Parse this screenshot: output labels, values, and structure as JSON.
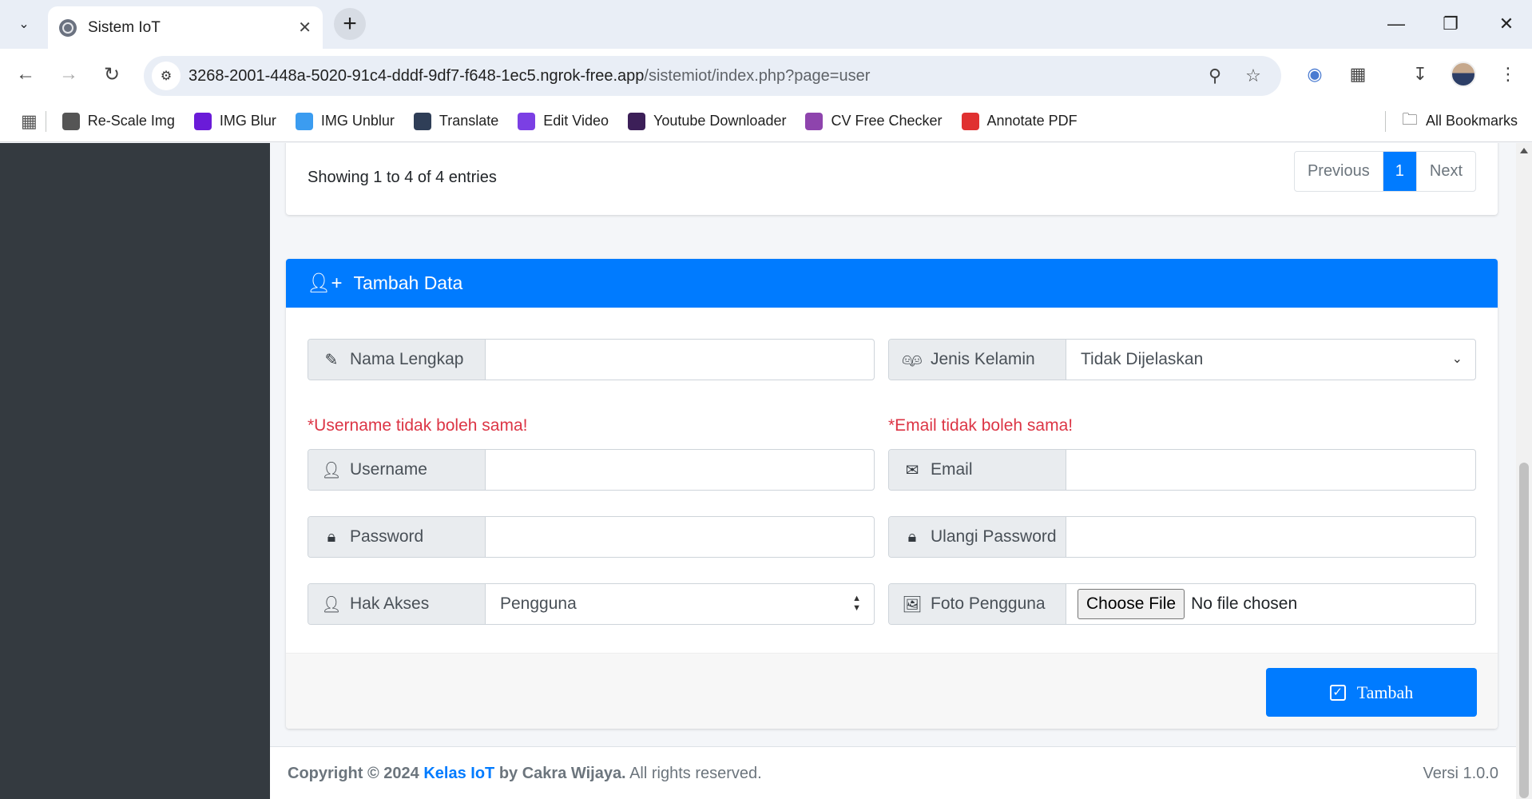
{
  "browser": {
    "tab_title": "Sistem IoT",
    "url_domain": "3268-2001-448a-5020-91c4-dddf-9df7-f648-1ec5.ngrok-free.app",
    "url_path": "/sistemiot/index.php?page=user",
    "bookmarks": [
      {
        "label": "Re-Scale Img",
        "icon": "rescale-icon",
        "color": "#555555"
      },
      {
        "label": "IMG Blur",
        "icon": "img-blur-icon",
        "color": "#6a1bd8"
      },
      {
        "label": "IMG Unblur",
        "icon": "img-unblur-icon",
        "color": "#3b9cf0"
      },
      {
        "label": "Translate",
        "icon": "translate-icon",
        "color": "#2f3e57"
      },
      {
        "label": "Edit Video",
        "icon": "edit-video-icon",
        "color": "#7b3fe4"
      },
      {
        "label": "Youtube Downloader",
        "icon": "youtube-downloader-icon",
        "color": "#3c1f58"
      },
      {
        "label": "CV Free Checker",
        "icon": "cv-checker-icon",
        "color": "#8e44ad"
      },
      {
        "label": "Annotate PDF",
        "icon": "annotate-pdf-icon",
        "color": "#e03131"
      }
    ],
    "all_bookmarks": "All Bookmarks"
  },
  "table_footer": {
    "entries_info": "Showing 1 to 4 of 4 entries",
    "prev": "Previous",
    "page": "1",
    "next": "Next"
  },
  "form": {
    "title": "Tambah Data",
    "nama_label": "Nama Lengkap",
    "nama_value": "",
    "gender_label": "Jenis Kelamin",
    "gender_value": "Tidak Dijelaskan",
    "username_warning": "*Username tidak boleh sama!",
    "email_warning": "*Email tidak boleh sama!",
    "username_label": "Username",
    "username_value": "",
    "email_label": "Email",
    "email_value": "",
    "password_label": "Password",
    "password_value": "",
    "repassword_label": "Ulangi Password",
    "repassword_value": "",
    "akses_label": "Hak Akses",
    "akses_value": "Pengguna",
    "foto_label": "Foto Pengguna",
    "file_button": "Choose File",
    "file_status": "No file chosen",
    "submit": "Tambah"
  },
  "footer": {
    "copyright_prefix": "Copyright © 2024",
    "brand": "Kelas IoT",
    "author": "by Cakra Wijaya.",
    "rights": "All rights reserved.",
    "version": "Versi 1.0.0"
  },
  "colors": {
    "primary": "#007bff",
    "sidebar": "#343a40",
    "danger": "#dc3545"
  }
}
